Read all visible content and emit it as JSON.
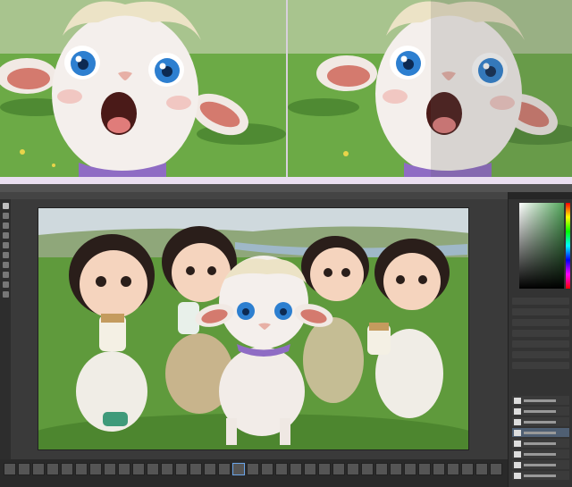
{
  "screen": {
    "before_panel": {
      "description_free": true
    },
    "after_panel": {
      "description_free": true
    }
  },
  "app": {
    "menu": [
      "",
      "",
      "",
      "",
      "",
      "",
      ""
    ],
    "options": "",
    "status": "",
    "timeline_label": ""
  },
  "colors": {
    "panel_bg": "#3a3a3a",
    "accent": "#6aa5e8",
    "fur": "#f2ece8",
    "eye": "#2d7fd0",
    "collar": "#8f6cc4",
    "grass": "#5e9e3a"
  },
  "icons": [
    "move-icon",
    "marquee-icon",
    "lasso-icon",
    "crop-icon",
    "brush-icon",
    "eraser-icon",
    "gradient-icon",
    "text-icon",
    "hand-icon",
    "zoom-icon"
  ]
}
